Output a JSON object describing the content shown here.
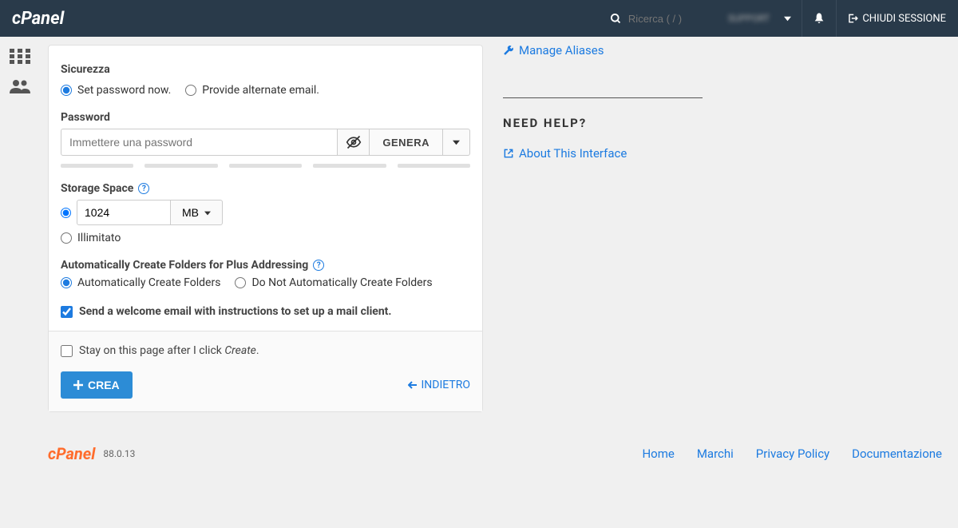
{
  "header": {
    "logo": "cPanel",
    "search_placeholder": "Ricerca ( / )",
    "user": "SUPPORT",
    "logout": "CHIUDI SESSIONE"
  },
  "form": {
    "security_label": "Sicurezza",
    "radio_set_password": "Set password now.",
    "radio_alt_email": "Provide alternate email.",
    "password_label": "Password",
    "password_placeholder": "Immettere una password",
    "generate_label": "GENERA",
    "storage_label": "Storage Space",
    "storage_value": "1024",
    "storage_unit": "MB",
    "unlimited_label": "Illimitato",
    "plus_label": "Automatically Create Folders for Plus Addressing",
    "plus_yes": "Automatically Create Folders",
    "plus_no": "Do Not Automatically Create Folders",
    "welcome_label": "Send a welcome email with instructions to set up a mail client.",
    "stay_prefix": "Stay on this page after I click ",
    "stay_italic": "Create",
    "create_btn": "CREA",
    "back_btn": "INDIETRO"
  },
  "right": {
    "manage_aliases": "Manage Aliases",
    "need_help": "NEED HELP?",
    "about": "About This Interface"
  },
  "footer": {
    "logo": "cPanel",
    "version": "88.0.13",
    "links": {
      "home": "Home",
      "marchi": "Marchi",
      "privacy": "Privacy Policy",
      "docs": "Documentazione"
    }
  }
}
